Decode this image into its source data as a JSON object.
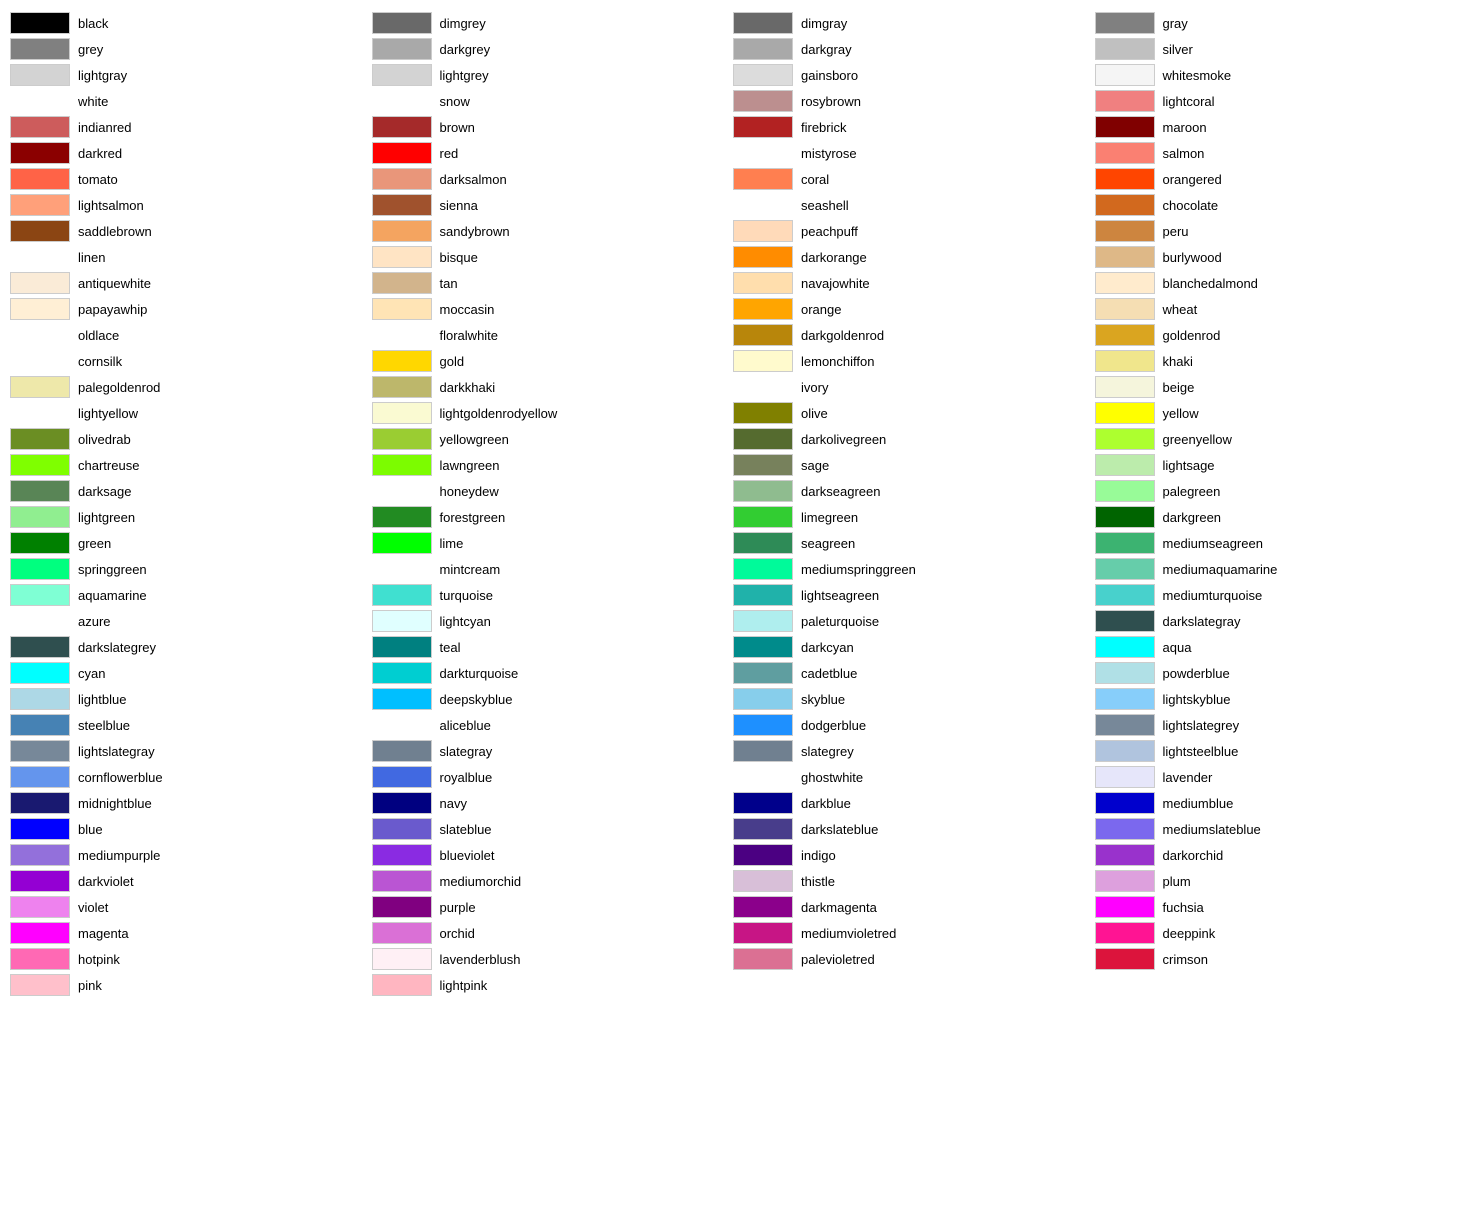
{
  "columns": [
    [
      {
        "name": "black",
        "color": "#000000"
      },
      {
        "name": "grey",
        "color": "#808080"
      },
      {
        "name": "lightgray",
        "color": "#d3d3d3"
      },
      {
        "name": "white",
        "color": null
      },
      {
        "name": "indianred",
        "color": "#cd5c5c"
      },
      {
        "name": "darkred",
        "color": "#8b0000"
      },
      {
        "name": "tomato",
        "color": "#ff6347"
      },
      {
        "name": "lightsalmon",
        "color": "#ffa07a"
      },
      {
        "name": "saddlebrown",
        "color": "#8b4513"
      },
      {
        "name": "linen",
        "color": null
      },
      {
        "name": "antiquewhite",
        "color": "#faebd7"
      },
      {
        "name": "papayawhip",
        "color": "#ffefd5"
      },
      {
        "name": "oldlace",
        "color": null
      },
      {
        "name": "cornsilk",
        "color": null
      },
      {
        "name": "palegoldenrod",
        "color": "#eee8aa"
      },
      {
        "name": "lightyellow",
        "color": null
      },
      {
        "name": "olivedrab",
        "color": "#6b8e23"
      },
      {
        "name": "chartreuse",
        "color": "#7fff00"
      },
      {
        "name": "darksage",
        "color": "#598556"
      },
      {
        "name": "lightgreen",
        "color": "#90ee90"
      },
      {
        "name": "green",
        "color": "#008000"
      },
      {
        "name": "springgreen",
        "color": "#00ff7f"
      },
      {
        "name": "aquamarine",
        "color": "#7fffd4"
      },
      {
        "name": "azure",
        "color": null
      },
      {
        "name": "darkslategrey",
        "color": "#2f4f4f"
      },
      {
        "name": "cyan",
        "color": "#00ffff"
      },
      {
        "name": "lightblue",
        "color": "#add8e6"
      },
      {
        "name": "steelblue",
        "color": "#4682b4"
      },
      {
        "name": "lightslategray",
        "color": "#778899"
      },
      {
        "name": "cornflowerblue",
        "color": "#6495ed"
      },
      {
        "name": "midnightblue",
        "color": "#191970"
      },
      {
        "name": "blue",
        "color": "#0000ff"
      },
      {
        "name": "mediumpurple",
        "color": "#9370db"
      },
      {
        "name": "darkviolet",
        "color": "#9400d3"
      },
      {
        "name": "violet",
        "color": "#ee82ee"
      },
      {
        "name": "magenta",
        "color": "#ff00ff"
      },
      {
        "name": "hotpink",
        "color": "#ff69b4"
      },
      {
        "name": "pink",
        "color": "#ffc0cb"
      }
    ],
    [
      {
        "name": "dimgrey",
        "color": "#696969"
      },
      {
        "name": "darkgrey",
        "color": "#a9a9a9"
      },
      {
        "name": "lightgrey",
        "color": "#d3d3d3"
      },
      {
        "name": "snow",
        "color": null
      },
      {
        "name": "brown",
        "color": "#a52a2a"
      },
      {
        "name": "red",
        "color": "#ff0000"
      },
      {
        "name": "darksalmon",
        "color": "#e9967a"
      },
      {
        "name": "sienna",
        "color": "#a0522d"
      },
      {
        "name": "sandybrown",
        "color": "#f4a460"
      },
      {
        "name": "bisque",
        "color": "#ffe4c4"
      },
      {
        "name": "tan",
        "color": "#d2b48c"
      },
      {
        "name": "moccasin",
        "color": "#ffe4b5"
      },
      {
        "name": "floralwhite",
        "color": null
      },
      {
        "name": "gold",
        "color": "#ffd700"
      },
      {
        "name": "darkkhaki",
        "color": "#bdb76b"
      },
      {
        "name": "lightgoldenrodyellow",
        "color": "#fafad2"
      },
      {
        "name": "yellowgreen",
        "color": "#9acd32"
      },
      {
        "name": "lawngreen",
        "color": "#7cfc00"
      },
      {
        "name": "honeydew",
        "color": null
      },
      {
        "name": "forestgreen",
        "color": "#228b22"
      },
      {
        "name": "lime",
        "color": "#00ff00"
      },
      {
        "name": "mintcream",
        "color": null
      },
      {
        "name": "turquoise",
        "color": "#40e0d0"
      },
      {
        "name": "lightcyan",
        "color": "#e0ffff"
      },
      {
        "name": "teal",
        "color": "#008080"
      },
      {
        "name": "darkturquoise",
        "color": "#00ced1"
      },
      {
        "name": "deepskyblue",
        "color": "#00bfff"
      },
      {
        "name": "aliceblue",
        "color": null
      },
      {
        "name": "slategray",
        "color": "#708090"
      },
      {
        "name": "royalblue",
        "color": "#4169e1"
      },
      {
        "name": "navy",
        "color": "#000080"
      },
      {
        "name": "slateblue",
        "color": "#6a5acd"
      },
      {
        "name": "blueviolet",
        "color": "#8a2be2"
      },
      {
        "name": "mediumorchid",
        "color": "#ba55d3"
      },
      {
        "name": "purple",
        "color": "#800080"
      },
      {
        "name": "orchid",
        "color": "#da70d6"
      },
      {
        "name": "lavenderblush",
        "color": "#fff0f5"
      },
      {
        "name": "lightpink",
        "color": "#ffb6c1"
      }
    ],
    [
      {
        "name": "dimgray",
        "color": "#696969"
      },
      {
        "name": "darkgray",
        "color": "#a9a9a9"
      },
      {
        "name": "gainsboro",
        "color": "#dcdcdc"
      },
      {
        "name": "rosybrown",
        "color": "#bc8f8f"
      },
      {
        "name": "firebrick",
        "color": "#b22222"
      },
      {
        "name": "mistyrose",
        "color": null
      },
      {
        "name": "coral",
        "color": "#ff7f50"
      },
      {
        "name": "seashell",
        "color": null
      },
      {
        "name": "peachpuff",
        "color": "#ffdab9"
      },
      {
        "name": "darkorange",
        "color": "#ff8c00"
      },
      {
        "name": "navajowhite",
        "color": "#ffdead"
      },
      {
        "name": "orange",
        "color": "#ffa500"
      },
      {
        "name": "darkgoldenrod",
        "color": "#b8860b"
      },
      {
        "name": "lemonchiffon",
        "color": "#fffacd"
      },
      {
        "name": "ivory",
        "color": null
      },
      {
        "name": "olive",
        "color": "#808000"
      },
      {
        "name": "darkolivegreen",
        "color": "#556b2f"
      },
      {
        "name": "sage",
        "color": "#77815c"
      },
      {
        "name": "darkseagreen",
        "color": "#8fbc8f"
      },
      {
        "name": "limegreen",
        "color": "#32cd32"
      },
      {
        "name": "seagreen",
        "color": "#2e8b57"
      },
      {
        "name": "mediumspringgreen",
        "color": "#00fa9a"
      },
      {
        "name": "lightseagreen",
        "color": "#20b2aa"
      },
      {
        "name": "paleturquoise",
        "color": "#afeeee"
      },
      {
        "name": "darkcyan",
        "color": "#008b8b"
      },
      {
        "name": "cadetblue",
        "color": "#5f9ea0"
      },
      {
        "name": "skyblue",
        "color": "#87ceeb"
      },
      {
        "name": "dodgerblue",
        "color": "#1e90ff"
      },
      {
        "name": "slategrey",
        "color": "#708090"
      },
      {
        "name": "ghostwhite",
        "color": null
      },
      {
        "name": "darkblue",
        "color": "#00008b"
      },
      {
        "name": "darkslateblue",
        "color": "#483d8b"
      },
      {
        "name": "indigo",
        "color": "#4b0082"
      },
      {
        "name": "thistle",
        "color": "#d8bfd8"
      },
      {
        "name": "darkmagenta",
        "color": "#8b008b"
      },
      {
        "name": "mediumvioletred",
        "color": "#c71585"
      },
      {
        "name": "palevioletred",
        "color": "#db7093"
      }
    ],
    [
      {
        "name": "gray",
        "color": "#808080"
      },
      {
        "name": "silver",
        "color": "#c0c0c0"
      },
      {
        "name": "whitesmoke",
        "color": "#f5f5f5"
      },
      {
        "name": "lightcoral",
        "color": "#f08080"
      },
      {
        "name": "maroon",
        "color": "#800000"
      },
      {
        "name": "salmon",
        "color": "#fa8072"
      },
      {
        "name": "orangered",
        "color": "#ff4500"
      },
      {
        "name": "chocolate",
        "color": "#d2691e"
      },
      {
        "name": "peru",
        "color": "#cd853f"
      },
      {
        "name": "burlywood",
        "color": "#deb887"
      },
      {
        "name": "blanchedalmond",
        "color": "#ffebcd"
      },
      {
        "name": "wheat",
        "color": "#f5deb3"
      },
      {
        "name": "goldenrod",
        "color": "#daa520"
      },
      {
        "name": "khaki",
        "color": "#f0e68c"
      },
      {
        "name": "beige",
        "color": "#f5f5dc"
      },
      {
        "name": "yellow",
        "color": "#ffff00"
      },
      {
        "name": "greenyellow",
        "color": "#adff2f"
      },
      {
        "name": "lightsage",
        "color": "#bcecac"
      },
      {
        "name": "palegreen",
        "color": "#98fb98"
      },
      {
        "name": "darkgreen",
        "color": "#006400"
      },
      {
        "name": "mediumseagreen",
        "color": "#3cb371"
      },
      {
        "name": "mediumaquamarine",
        "color": "#66cdaa"
      },
      {
        "name": "mediumturquoise",
        "color": "#48d1cc"
      },
      {
        "name": "darkslategray",
        "color": "#2f4f4f"
      },
      {
        "name": "aqua",
        "color": "#00ffff"
      },
      {
        "name": "powderblue",
        "color": "#b0e0e6"
      },
      {
        "name": "lightskyblue",
        "color": "#87cefa"
      },
      {
        "name": "lightslategrey",
        "color": "#778899"
      },
      {
        "name": "lightsteelblue",
        "color": "#b0c4de"
      },
      {
        "name": "lavender",
        "color": "#e6e6fa"
      },
      {
        "name": "mediumblue",
        "color": "#0000cd"
      },
      {
        "name": "mediumslateblue",
        "color": "#7b68ee"
      },
      {
        "name": "darkorchid",
        "color": "#9932cc"
      },
      {
        "name": "plum",
        "color": "#dda0dd"
      },
      {
        "name": "fuchsia",
        "color": "#ff00ff"
      },
      {
        "name": "deeppink",
        "color": "#ff1493"
      },
      {
        "name": "crimson",
        "color": "#dc143c"
      }
    ]
  ]
}
